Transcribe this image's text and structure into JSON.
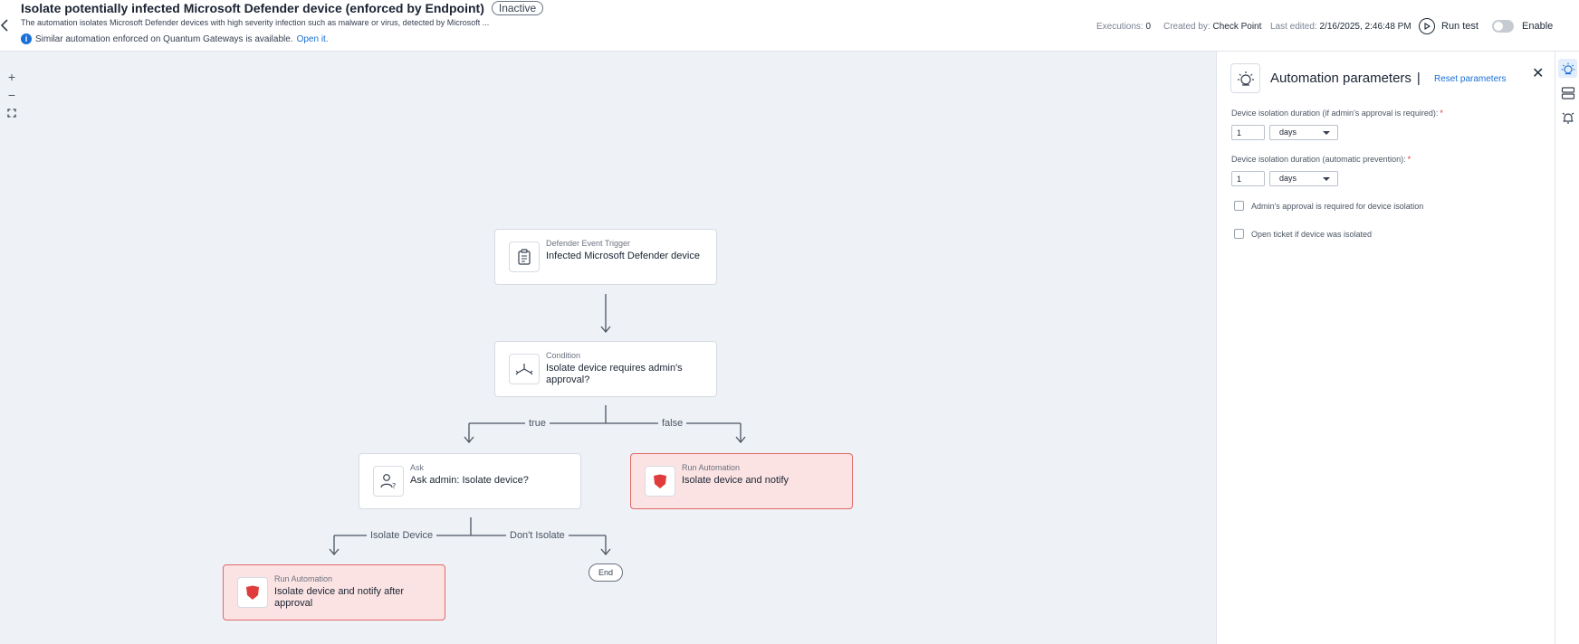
{
  "header": {
    "title": "Isolate potentially infected Microsoft Defender device (enforced by Endpoint)",
    "status": "Inactive",
    "description": "The automation isolates Microsoft Defender devices with high severity infection such as malware or virus, detected by Microsoft ...",
    "notice_text": "Similar automation enforced on Quantum Gateways is available.",
    "notice_link": "Open it.",
    "executions_label": "Executions:",
    "executions_value": "0",
    "created_label": "Created by:",
    "created_value": "Check Point",
    "edited_label": "Last edited:",
    "edited_value": "2/16/2025, 2:46:48 PM",
    "run_test_label": "Run test",
    "enable_label": "Enable"
  },
  "canvas": {
    "zoom_in": "+",
    "zoom_out": "−",
    "fit": "⛶",
    "nodes": [
      {
        "kind": "Defender Event Trigger",
        "name": "Infected Microsoft Defender device"
      },
      {
        "kind": "Condition",
        "name": "Isolate device requires admin's approval?"
      },
      {
        "kind": "Ask",
        "name": "Ask admin: Isolate device?"
      },
      {
        "kind": "Run Automation",
        "name": "Isolate device and notify"
      },
      {
        "kind": "Run Automation",
        "name": "Isolate device and notify after approval"
      }
    ],
    "edge_labels": {
      "true": "true",
      "false": "false",
      "isolate": "Isolate Device",
      "dont_isolate": "Don't Isolate"
    },
    "end_label": "End"
  },
  "panel": {
    "title": "Automation parameters",
    "separator": "|",
    "reset_label": "Reset parameters",
    "fields": [
      {
        "label": "Device isolation duration (if admin's approval is required):",
        "value": "1",
        "unit": "days"
      },
      {
        "label": "Device isolation duration (automatic prevention):",
        "value": "1",
        "unit": "days"
      }
    ],
    "required_mark": "*",
    "checkboxes": [
      {
        "label": "Admin's approval is required for device isolation"
      },
      {
        "label": "Open ticket if device was isolated"
      }
    ]
  },
  "colors": {
    "accent": "#1a6fd6",
    "canvas_bg": "#eef1f6",
    "alert_node_bg": "#fbe3e3",
    "alert_node_border": "#e16868",
    "shield": "#e03c3c"
  }
}
